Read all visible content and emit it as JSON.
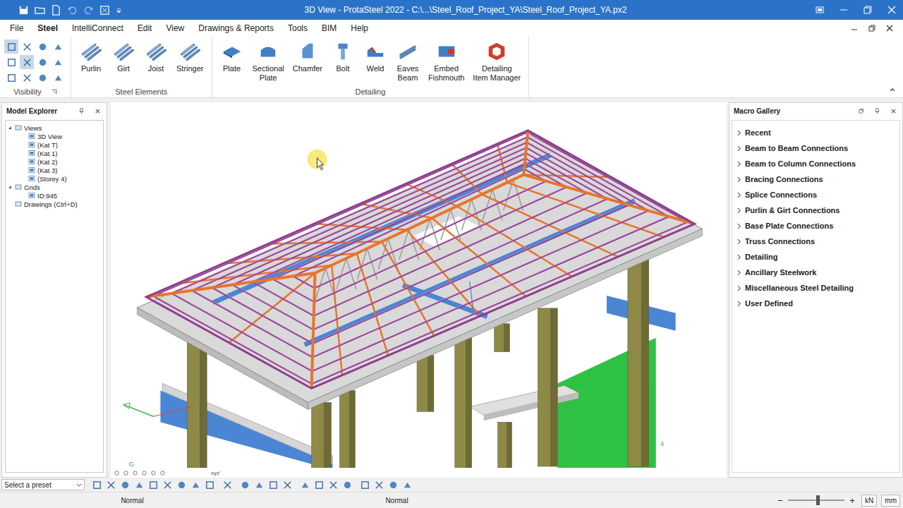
{
  "window": {
    "title": "3D View - ProtaSteel 2022 - C:\\...\\Steel_Roof_Project_YA\\Steel_Roof_Project_YA.px2"
  },
  "menu": [
    {
      "label": "File",
      "selected": false
    },
    {
      "label": "Steel",
      "selected": true
    },
    {
      "label": "IntelliConnect",
      "selected": false
    },
    {
      "label": "Edit",
      "selected": false
    },
    {
      "label": "View",
      "selected": false
    },
    {
      "label": "Drawings & Reports",
      "selected": false
    },
    {
      "label": "Tools",
      "selected": false
    },
    {
      "label": "BIM",
      "selected": false
    },
    {
      "label": "Help",
      "selected": false
    }
  ],
  "ribbon": {
    "visibility": {
      "label": "Visibility",
      "tools": [
        {
          "selected": true
        },
        {
          "selected": false
        },
        {
          "selected": false
        },
        {
          "selected": false
        },
        {
          "selected": false
        },
        {
          "selected": true
        },
        {
          "selected": false
        },
        {
          "selected": false
        },
        {
          "selected": false
        },
        {
          "selected": false
        },
        {
          "selected": false
        },
        {
          "selected": false
        }
      ]
    },
    "groups": [
      {
        "label": "Steel Elements",
        "items": [
          {
            "lines": [
              "Purlin"
            ]
          },
          {
            "lines": [
              "Girt"
            ]
          },
          {
            "lines": [
              "Joist"
            ]
          },
          {
            "lines": [
              "Stringer"
            ]
          }
        ]
      },
      {
        "label": "Detailing",
        "items": [
          {
            "lines": [
              "Plate"
            ]
          },
          {
            "lines": [
              "Sectional",
              "Plate"
            ]
          },
          {
            "lines": [
              "Chamfer"
            ]
          },
          {
            "lines": [
              "Bolt"
            ]
          },
          {
            "lines": [
              "Weld"
            ]
          },
          {
            "lines": [
              "Eaves",
              "Beam"
            ]
          },
          {
            "lines": [
              "Embed",
              "Fishmouth"
            ]
          },
          {
            "lines": [
              "Detailing",
              "Item Manager"
            ]
          }
        ]
      }
    ]
  },
  "model_explorer": {
    "title": "Model Explorer",
    "tree": [
      {
        "label": "Views",
        "expanded": true,
        "children": [
          "3D View",
          "(Kat T)",
          "(Kat 1)",
          "(Kat 2)",
          "(Kat 3)",
          "(Storey 4)"
        ]
      },
      {
        "label": "Grids",
        "expanded": true,
        "children": [
          "ID:945"
        ]
      },
      {
        "label": "Drawings (Ctrl+D)",
        "expanded": false,
        "children": []
      }
    ]
  },
  "macro_gallery": {
    "title": "Macro Gallery",
    "items": [
      {
        "label": "Recent",
        "expanded": false
      },
      {
        "label": "Beam to Beam Connections",
        "expanded": false
      },
      {
        "label": "Beam to Column Connections",
        "expanded": false
      },
      {
        "label": "Bracing Connections",
        "expanded": false
      },
      {
        "label": "Splice Connections",
        "expanded": false
      },
      {
        "label": "Purlin & Girt Connections",
        "expanded": false
      },
      {
        "label": "Base Plate Connections",
        "expanded": false
      },
      {
        "label": "Truss Connections",
        "expanded": false
      },
      {
        "label": "Detailing",
        "expanded": false
      },
      {
        "label": "Ancillary Steelwork",
        "expanded": false
      },
      {
        "label": "Miscellaneous Steel Detailing",
        "expanded": false
      },
      {
        "label": "User Defined",
        "expanded": false
      }
    ]
  },
  "viewport": {
    "axis_labels": [
      "G",
      "4"
    ],
    "toolbar_text": "xyz'"
  },
  "bottom_toolbar": {
    "preset": {
      "placeholder": "Select a preset"
    }
  },
  "status_bar": {
    "modes": [
      "Normal",
      "Normal"
    ],
    "zoom": {
      "minus": "−",
      "plus": "+",
      "level": 0.5
    },
    "units": [
      "kN",
      "mm"
    ]
  }
}
